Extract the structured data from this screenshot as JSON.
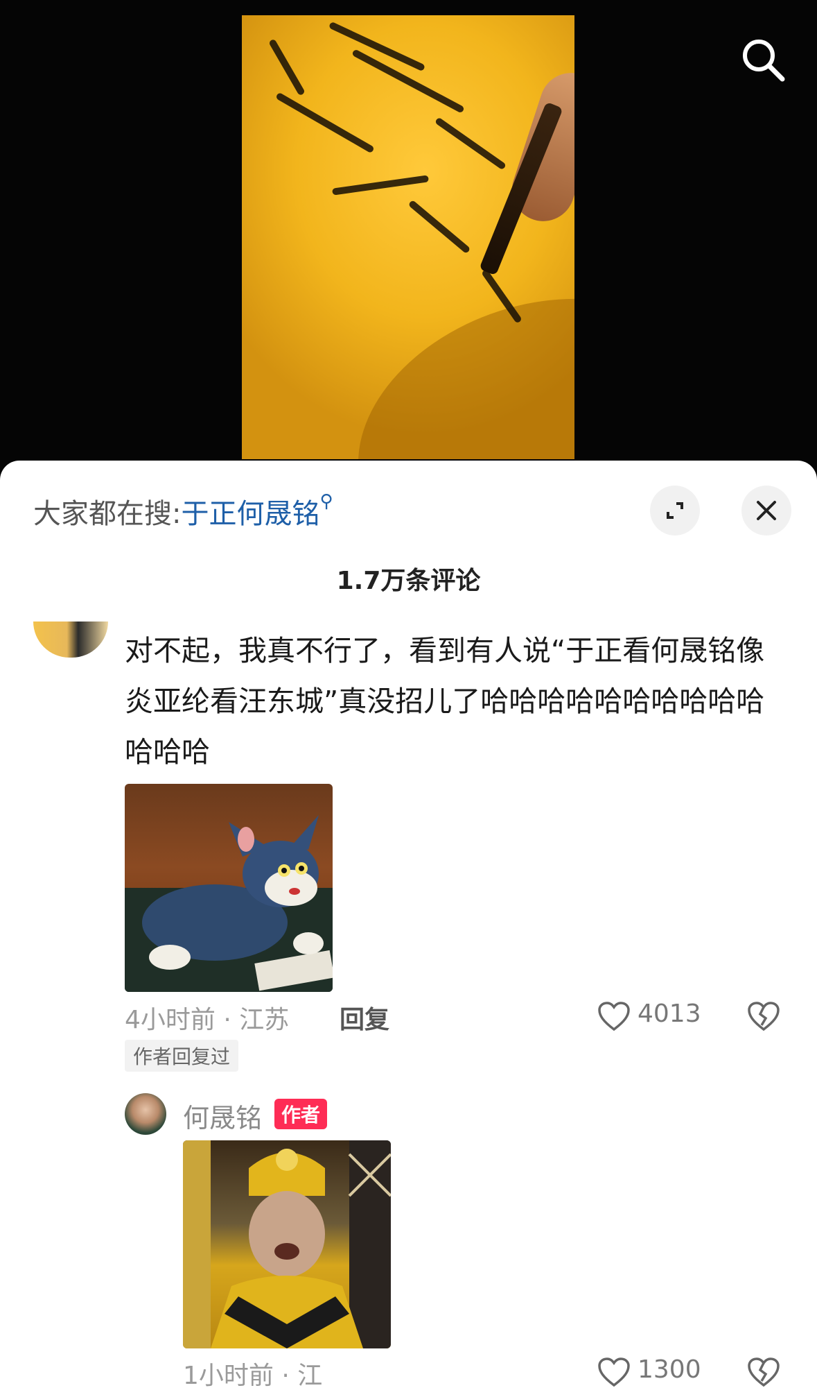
{
  "search_suggestion": {
    "prefix": "大家都在搜:",
    "term": "于正何晟铭"
  },
  "comments_header": {
    "count_label": "1.7万条评论"
  },
  "comment": {
    "text": "对不起，我真不行了，看到有人说“于正看何晟铭像炎亚纶看汪东城”真没招儿了哈哈哈哈哈哈哈哈哈哈哈哈哈",
    "time_location": "4小时前 · 江苏",
    "reply_label": "回复",
    "like_count": "4013",
    "author_replied_tag": "作者回复过",
    "image": "tom-cat-sticker"
  },
  "reply": {
    "author_name": "何晟铭",
    "author_badge": "作者",
    "time_location": "1小时前 · 江",
    "like_count": "1300",
    "image": "monk-sticker"
  },
  "icons": {
    "search": "search-icon",
    "expand": "expand-icon",
    "close": "close-icon",
    "like": "heart-icon",
    "dislike": "broken-heart-icon"
  }
}
